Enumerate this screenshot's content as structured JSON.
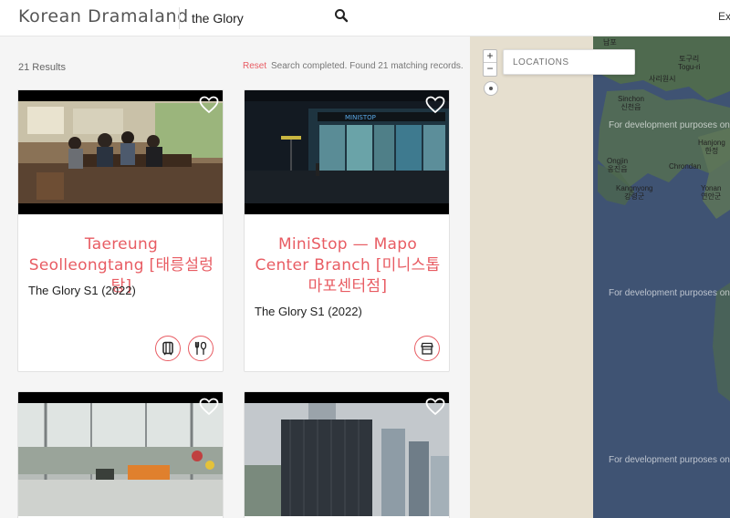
{
  "header": {
    "brand": "Korean Dramaland",
    "search_value": "the Glory",
    "right_text": "Ex"
  },
  "results": {
    "count_text": "21 Results",
    "reset_label": "Reset",
    "status_text": "Search completed. Found 21 matching records.",
    "cards": [
      {
        "title": "Taereung Seolleongtang [태릉설렁탕]",
        "subtitle": "The Glory S1 (2022)",
        "categories": [
          "metro-icon",
          "restaurant-icon"
        ]
      },
      {
        "title": "MiniStop — Mapo Center Branch [미니스톱 마포센터점]",
        "subtitle": "The Glory S1 (2022)",
        "sign_text": "MINISTOP",
        "categories": [
          "store-icon"
        ]
      },
      {
        "title": "",
        "subtitle": "",
        "categories": []
      },
      {
        "title": "",
        "subtitle": "",
        "categories": []
      }
    ]
  },
  "map": {
    "zoom_in": "+",
    "zoom_out": "−",
    "location_placeholder": "LOCATIONS",
    "dev_notice": "For development purposes only",
    "places": [
      {
        "ko": "납포",
        "en": ""
      },
      {
        "ko": "토구리",
        "en": "Togu-ri"
      },
      {
        "ko": "사리원시",
        "en": ""
      },
      {
        "ko": "신천읍",
        "en": "Sinchon"
      },
      {
        "ko": "한정",
        "en": "Hanjong"
      },
      {
        "ko": "옹진읍",
        "en": "Ongjin"
      },
      {
        "ko": "",
        "en": "Chrondan"
      },
      {
        "ko": "강령군",
        "en": "Kangnyong"
      },
      {
        "ko": "연안군",
        "en": "Yonan"
      }
    ],
    "colors": {
      "water": "#3f5373",
      "land": "#e6dfcf",
      "land_dark": "#4f6a4f"
    }
  }
}
